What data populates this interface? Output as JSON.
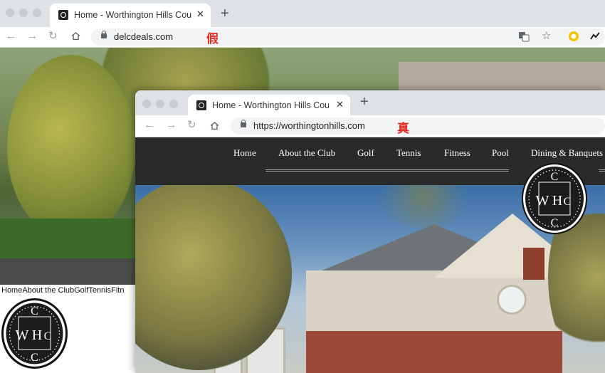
{
  "outer_browser": {
    "tab_title": "Home - Worthington Hills Coun",
    "url": "delcdeals.com",
    "warning_label": "假"
  },
  "outer_page": {
    "nav_items": [
      "Home",
      "About the Club",
      "Golf",
      "Tennis",
      "Fitn"
    ],
    "logo_letters": {
      "top": "C",
      "left": "W",
      "center": "H",
      "right": "C",
      "bottom": "C"
    }
  },
  "inner_browser": {
    "tab_title": "Home - Worthington Hills Cour",
    "url": "https://worthingtonhills.com",
    "warning_label": "真"
  },
  "site": {
    "nav": [
      "Home",
      "About the Club",
      "Golf",
      "Tennis",
      "Fitness",
      "Pool",
      "Dining & Banquets"
    ],
    "logo_letters": {
      "top": "C",
      "left": "W",
      "center": "H",
      "right": "C",
      "bottom": "C"
    }
  }
}
